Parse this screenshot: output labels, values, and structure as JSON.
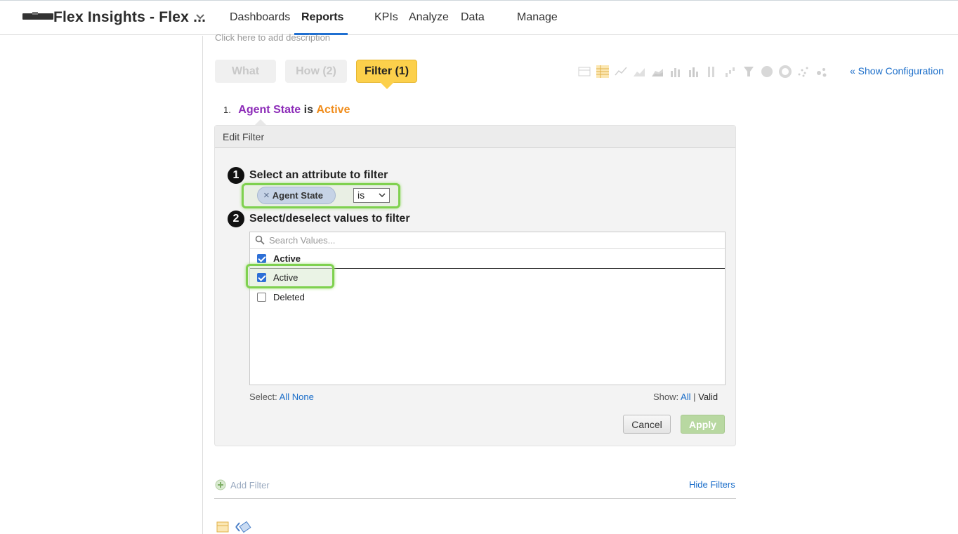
{
  "header": {
    "app_title": "Flex Insights - Flex ...",
    "nav": [
      "Dashboards",
      "Reports",
      "KPIs",
      "Analyze",
      "Data",
      "Manage"
    ],
    "active_nav": "Reports"
  },
  "report": {
    "description_placeholder": "Click here to add description",
    "tabs": {
      "what": "What",
      "how": "How (2)",
      "filter": "Filter (1)"
    },
    "show_configuration": "« Show Configuration",
    "chart_type_icons": [
      "table-icon",
      "pivot-icon",
      "line-icon",
      "area-line-icon",
      "stacked-area-icon",
      "bar-icon",
      "stacked-bar-icon",
      "column-icon",
      "waterfall-icon",
      "funnel-icon",
      "pie-icon",
      "donut-icon",
      "scatter-icon",
      "bubble-icon"
    ]
  },
  "filters": [
    {
      "number": "1.",
      "attribute": "Agent State",
      "operator": "is",
      "value": "Active"
    }
  ],
  "edit_filter": {
    "header": "Edit Filter",
    "step1": {
      "num": "1",
      "title": "Select an attribute to filter"
    },
    "attribute_pill": "Agent State",
    "operator_select": "is",
    "step2": {
      "num": "2",
      "title": "Select/deselect values to filter"
    },
    "search_placeholder": "Search Values...",
    "sticky_value": {
      "label": "Active",
      "checked": true
    },
    "values": [
      {
        "label": "Active",
        "checked": true
      },
      {
        "label": "Deleted",
        "checked": false
      }
    ],
    "select_label": "Select:",
    "select_all": "All",
    "select_none": "None",
    "show_label": "Show:",
    "show_all": "All",
    "show_sep": "|",
    "show_valid": "Valid",
    "cancel": "Cancel",
    "apply": "Apply"
  },
  "footer": {
    "add_filter": "Add Filter",
    "hide_filters": "Hide Filters"
  },
  "colors": {
    "accent_link": "#1a6dc9",
    "filter_tab": "#fcd04b",
    "attribute": "#8c2bb8",
    "value": "#f08c1a",
    "highlight": "#7fd14f"
  }
}
